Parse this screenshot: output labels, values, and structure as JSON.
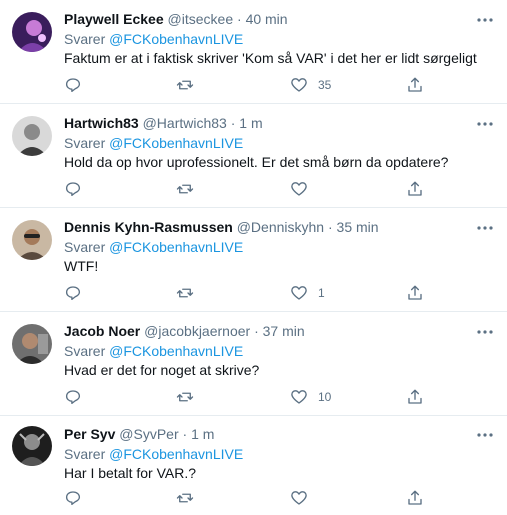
{
  "reply_prefix": "Svarer",
  "tweets": [
    {
      "name": "Playwell Eckee",
      "handle": "@itseckee",
      "separator": "·",
      "time": "40 min",
      "mention": "@FCKobenhavnLIVE",
      "text": "Faktum er at i faktisk skriver 'Kom så VAR' i det her er lidt sørgeligt",
      "likes": "35"
    },
    {
      "name": "Hartwich83",
      "handle": "@Hartwich83",
      "separator": "·",
      "time": "1 m",
      "mention": "@FCKobenhavnLIVE",
      "text": "Hold da op hvor uprofessionelt. Er det små børn da opdatere?",
      "likes": ""
    },
    {
      "name": "Dennis Kyhn-Rasmussen",
      "handle": "@Denniskyhn",
      "separator": "·",
      "time": "35 min",
      "mention": "@FCKobenhavnLIVE",
      "text": "WTF!",
      "likes": "1"
    },
    {
      "name": "Jacob Noer",
      "handle": "@jacobkjaernoer",
      "separator": "·",
      "time": "37 min",
      "mention": "@FCKobenhavnLIVE",
      "text": "Hvad er det for noget at skrive?",
      "likes": "10"
    },
    {
      "name": "Per Syv",
      "handle": "@SyvPer",
      "separator": "·",
      "time": "1 m",
      "mention": "@FCKobenhavnLIVE",
      "text": "Har I betalt for VAR.?",
      "likes": ""
    }
  ],
  "colors": {
    "link": "#1b95e0",
    "muted": "#5b7083",
    "text": "#0f1419",
    "divider": "#e6ecf0"
  },
  "icons": {
    "reply": "reply-icon",
    "retweet": "retweet-icon",
    "like": "heart-icon",
    "share": "share-icon",
    "more": "more-icon"
  }
}
